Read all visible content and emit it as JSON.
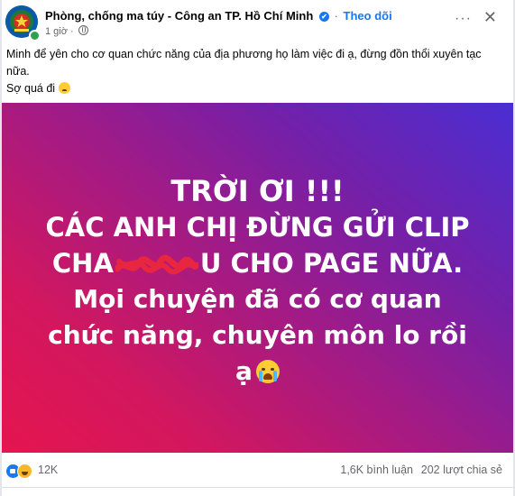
{
  "post": {
    "page_name": "Phòng, chống ma túy - Công an TP. Hồ Chí Minh",
    "verified_symbol": "✔",
    "separator": "·",
    "follow_label": "Theo dõi",
    "time": "1 giờ",
    "time_sep": "·",
    "more_symbol": "···",
    "close_symbol": "✕",
    "caption_line1": "Minh để yên cho cơ quan chức năng của địa phương họ làm việc đi ạ, đừng đồn thổi xuyên tạc nữa.",
    "caption_line2": "Sợ quá đi"
  },
  "media": {
    "line1": "TRỜI ƠI !!!",
    "line2": "CÁC ANH CHỊ ĐỪNG GỬI CLIP",
    "line3_prefix": "CHA",
    "line3_suffix": "U CHO PAGE NỮA.",
    "line4": "Mọi chuyện đã có cơ quan",
    "line5": "chức năng, chuyên môn lo rồi",
    "line6": "ạ",
    "gradient_colors": [
      "#e5154f",
      "#a01b87",
      "#4a2ed3"
    ],
    "censor_color": "#e8263f"
  },
  "footer": {
    "reaction_count": "12K",
    "comments": "1,6K bình luận",
    "shares": "202 lượt chia sẻ"
  },
  "colors": {
    "accent": "#1877f2",
    "secondary_text": "#65676b",
    "online": "#31a24c"
  }
}
